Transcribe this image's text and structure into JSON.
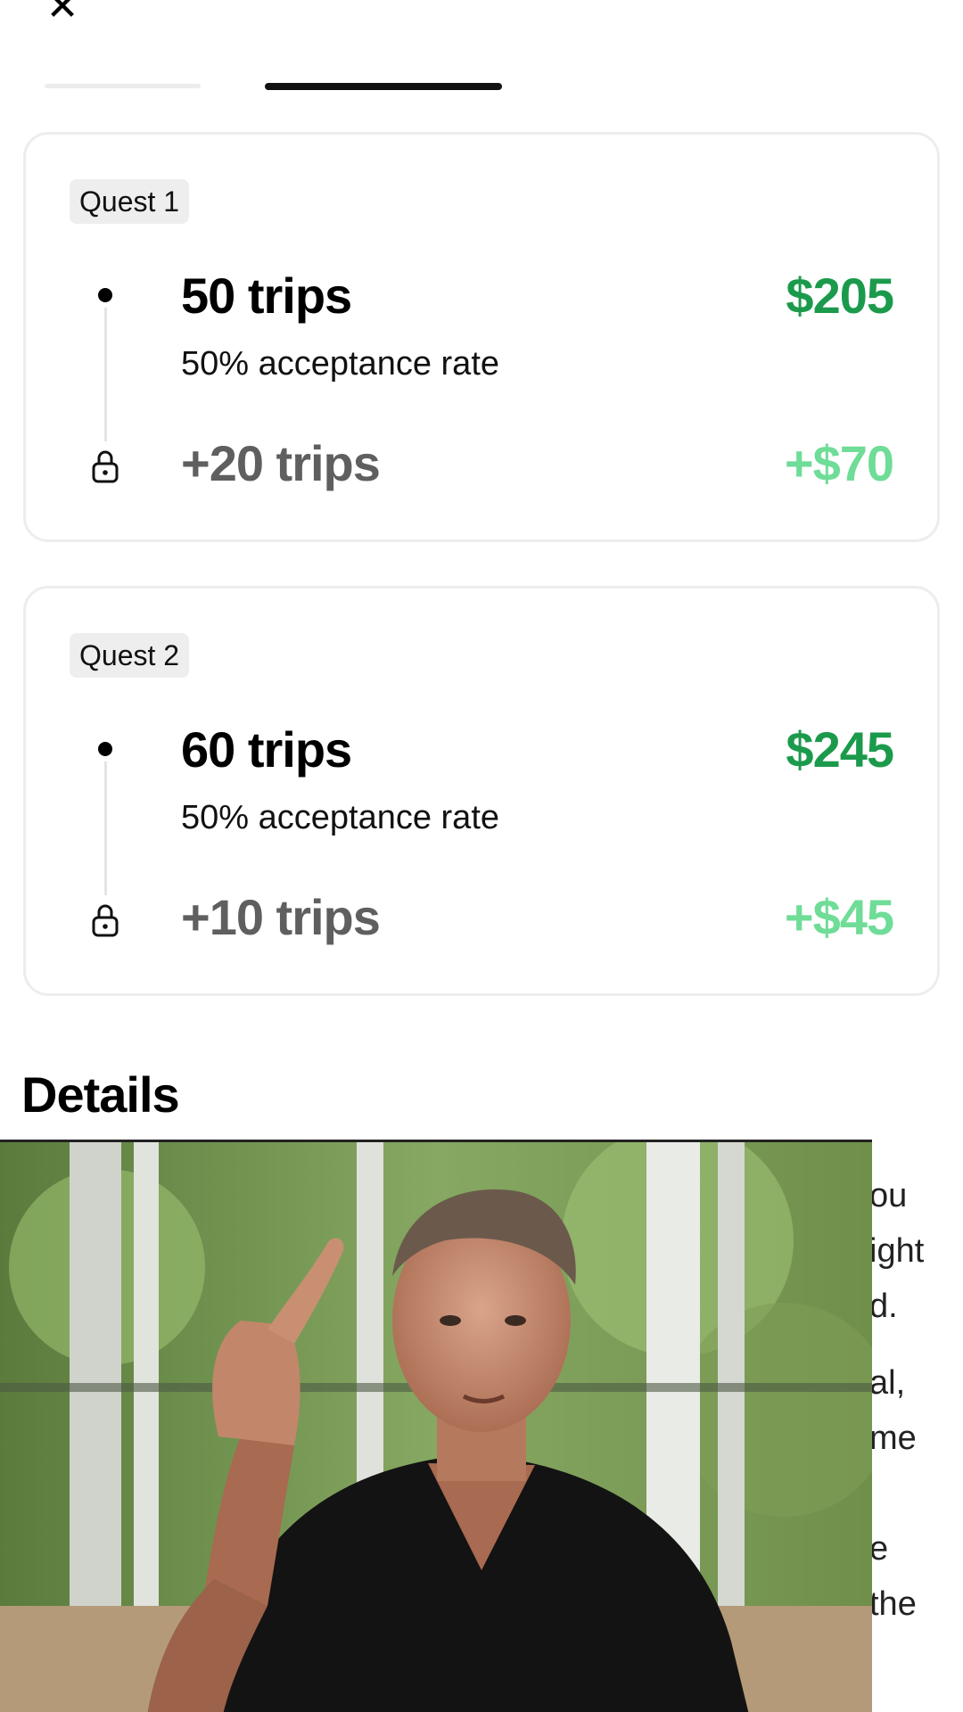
{
  "header": {
    "close_icon": "close-icon",
    "close_glyph": "✕"
  },
  "tabs": {
    "active_index": 1
  },
  "quests": [
    {
      "badge": "Quest 1",
      "tier_trips": "50 trips",
      "tier_reward": "$205",
      "tier_requirement": "50% acceptance rate",
      "bonus_trips": "+20 trips",
      "bonus_reward": "+$70",
      "bonus_icon": "lock-icon"
    },
    {
      "badge": "Quest 2",
      "tier_trips": "60 trips",
      "tier_reward": "$245",
      "tier_requirement": "50% acceptance rate",
      "bonus_trips": "+10 trips",
      "bonus_reward": "+$45",
      "bonus_icon": "lock-icon"
    }
  ],
  "details": {
    "heading": "Details",
    "visible_fragments": [
      "ou",
      "ight",
      "d.",
      "al,",
      "me",
      "e",
      "the"
    ]
  },
  "overlay": {
    "type": "video-frame"
  },
  "colors": {
    "reward_green": "#1c9a4c",
    "bonus_green": "#6fdc97",
    "bonus_gray": "#5f5f5f",
    "card_border": "#ededed",
    "badge_bg": "#eeeeee"
  }
}
